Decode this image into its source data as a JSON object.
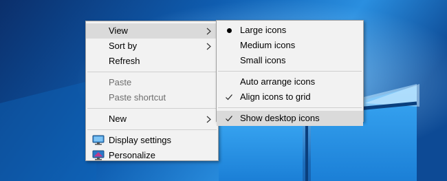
{
  "context_menu": {
    "items": [
      {
        "label": "View",
        "has_submenu": true,
        "highlighted": true
      },
      {
        "label": "Sort by",
        "has_submenu": true
      },
      {
        "label": "Refresh"
      },
      {
        "label": "Paste",
        "disabled": true
      },
      {
        "label": "Paste shortcut",
        "disabled": true
      },
      {
        "label": "New",
        "has_submenu": true
      },
      {
        "label": "Display settings",
        "icon": "display-settings-icon"
      },
      {
        "label": "Personalize",
        "icon": "personalize-icon"
      }
    ]
  },
  "view_submenu": {
    "items": [
      {
        "label": "Large icons",
        "marker": "bullet"
      },
      {
        "label": "Medium icons"
      },
      {
        "label": "Small icons"
      },
      {
        "label": "Auto arrange icons"
      },
      {
        "label": "Align icons to grid",
        "marker": "check"
      },
      {
        "label": "Show desktop icons",
        "marker": "check",
        "highlighted": true
      }
    ]
  },
  "colors": {
    "desktop_background": "#0a3f7d",
    "menu_background": "#f2f2f2",
    "menu_highlight": "#dadada",
    "disabled_text": "#6d6d6d"
  }
}
